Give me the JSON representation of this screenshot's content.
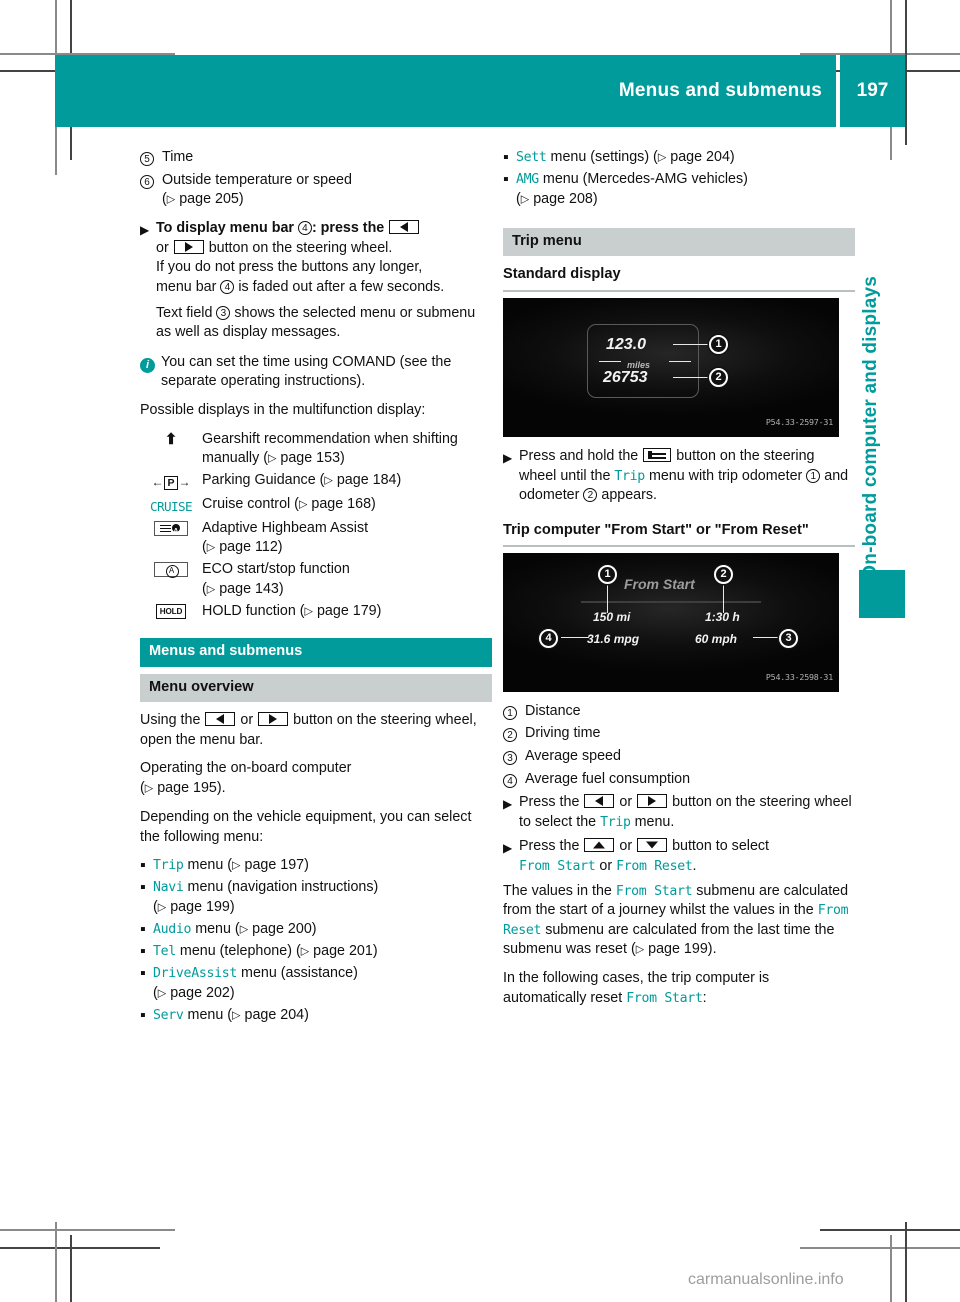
{
  "header": {
    "title": "Menus and submenus",
    "page_number": "197"
  },
  "side_tab": {
    "label": "On-board computer and displays"
  },
  "watermark": "carmanualsonline.info",
  "left_column": {
    "legend_items": [
      {
        "ref": "5",
        "text": "Time"
      },
      {
        "ref": "6",
        "text": "Outside temperature or speed",
        "page_ref": "page 205"
      }
    ],
    "step_menu_bar": {
      "bold_lead": "To display menu bar",
      "ref": "4",
      "after_ref": ": press the",
      "or_word": "or",
      "tail": "button on the steering wheel.",
      "line2": "If you do not press the buttons any longer,",
      "line2_ref": "4",
      "line2_tail": "is faded out after a few seconds.",
      "menu_bar_word": "menu bar",
      "line3_lead": "Text field",
      "line3_ref": "3",
      "line3_tail": "shows the selected menu or submenu as well as display messages."
    },
    "note": "You can set the time using COMAND (see the separate operating instructions).",
    "possible_displays_intro": "Possible displays in the multifunction display:",
    "symbol_rows": [
      {
        "icon": "gearshift-arrow-icon",
        "text": "Gearshift recommendation when shifting manually",
        "page_ref": "page 153"
      },
      {
        "icon": "parking-guidance-icon",
        "text": "Parking Guidance",
        "page_ref": "page 184"
      },
      {
        "icon": "cruise-icon",
        "icon_label": "CRUISE",
        "text": "Cruise control",
        "page_ref": "page 168"
      },
      {
        "icon": "adaptive-highbeam-icon",
        "text": "Adaptive Highbeam Assist",
        "page_ref": "page 112"
      },
      {
        "icon": "eco-start-stop-icon",
        "text": "ECO start/stop function",
        "page_ref": "page 143"
      },
      {
        "icon": "hold-icon",
        "icon_label": "HOLD",
        "text": "HOLD function",
        "page_ref": "page 179"
      }
    ],
    "section_heading": "Menus and submenus",
    "sub_heading": "Menu overview",
    "body": {
      "p1_lead": "Using the",
      "p1_or": "or",
      "p1_tail": "button on the steering wheel, open the menu bar.",
      "p2": "Operating the on-board computer",
      "p2_page_ref": "page 195",
      "p3": "Depending on the vehicle equipment, you can select the following menu:"
    },
    "menu_bullets": [
      {
        "name": "Trip",
        "desc": "menu",
        "page_ref": "page 197"
      },
      {
        "name": "Navi",
        "desc": "menu (navigation instructions)",
        "page_ref": "page 199"
      },
      {
        "name": "Audio",
        "desc": "menu",
        "page_ref": "page 200"
      },
      {
        "name": "Tel",
        "desc": "menu (telephone)",
        "page_ref": "page 201"
      },
      {
        "name": "DriveAssist",
        "desc": "menu (assistance)",
        "page_ref": "page 202"
      },
      {
        "name": "Serv",
        "desc": "menu",
        "page_ref": "page 204"
      }
    ]
  },
  "right_column": {
    "menu_bullets": [
      {
        "name": "Sett",
        "desc": "menu (settings)",
        "page_ref": "page 204"
      },
      {
        "name": "AMG",
        "desc": "menu (Mercedes-AMG vehicles)",
        "page_ref": "page 208"
      }
    ],
    "trip_menu_heading": "Trip menu",
    "standard_display_heading": "Standard display",
    "figure1": {
      "caption": "P54.33-2597-31",
      "values": [
        {
          "ref": "1",
          "text": "123.0"
        },
        {
          "ref": "2",
          "text": "26753"
        }
      ],
      "unit_label": "miles"
    },
    "step_press_hold": {
      "lead": "Press and hold the",
      "mid": "button on the steering wheel until the",
      "menu_name": "Trip",
      "tail": "menu with trip odometer",
      "ref1": "1",
      "and": "and odometer",
      "ref2": "2",
      "end": "appears."
    },
    "trip_computer_heading": "Trip computer \"From Start\" or \"From Reset\"",
    "figure2": {
      "caption": "P54.33-2598-31",
      "title": "From Start",
      "values": [
        {
          "ref": "1",
          "text": "150 mi"
        },
        {
          "ref": "2",
          "text": "1:30 h"
        },
        {
          "ref": "3",
          "text": "60 mph"
        },
        {
          "ref": "4",
          "text": "31.6 mpg"
        }
      ]
    },
    "legend_items": [
      {
        "ref": "1",
        "text": "Distance"
      },
      {
        "ref": "2",
        "text": "Driving time"
      },
      {
        "ref": "3",
        "text": "Average speed"
      },
      {
        "ref": "4",
        "text": "Average fuel consumption"
      }
    ],
    "step_select_trip": {
      "lead": "Press the",
      "or": "or",
      "mid": "button on the steering wheel to select the",
      "menu_name": "Trip",
      "tail": "menu."
    },
    "step_select_submenu": {
      "lead": "Press the",
      "or": "or",
      "mid": "button to select",
      "opt1": "From Start",
      "or2": "or",
      "opt2": "From Reset",
      "period": "."
    },
    "para_values": {
      "s1": "The values in the",
      "n1": "From Start",
      "s2": "submenu are calculated from the start of a journey whilst the values in the",
      "n2": "From Reset",
      "s3": "submenu are calculated from the last time the submenu was reset",
      "page_ref": "page 199",
      "s4": "."
    },
    "para_autoreset": {
      "s1": "In the following cases, the trip computer is automatically reset",
      "n1": "From Start",
      "s2": ":"
    }
  },
  "colors": {
    "teal": "#029b9b",
    "gray_header": "#c9cfcf",
    "text": "#111111"
  }
}
